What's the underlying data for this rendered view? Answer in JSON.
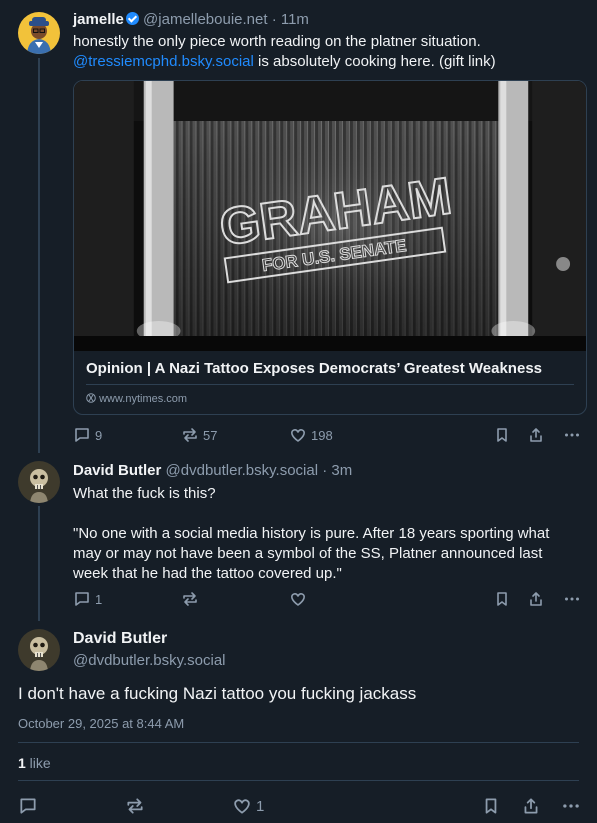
{
  "posts": [
    {
      "author_name": "jamelle",
      "handle": "@jamellebouie.net",
      "time": "· 11m",
      "text_line1": "honestly the only piece worth reading on the platner situation.",
      "mention": "@tressiemcphd.bsky.social",
      "text_line2_rest": " is absolutely cooking here. (gift link)",
      "card": {
        "image_text_main": "GRAHAM",
        "image_text_sub": "FOR U.S. SENATE",
        "title": "Opinion | A Nazi Tattoo Exposes Democrats’ Greatest Weakness",
        "domain": "www.nytimes.com"
      },
      "replies": "9",
      "reposts": "57",
      "likes": "198"
    },
    {
      "author_name": "David Butler",
      "handle": "@dvdbutler.bsky.social",
      "time": "· 3m",
      "text_line1": "What the fuck is this?",
      "quote_line1": "\"No one with a social media history is pure. After 18 years sporting what",
      "quote_line2": "may or may not have been a symbol of the SS, Platner announced last",
      "quote_line3": "week that he had the tattoo covered up.\"",
      "replies": "1",
      "reposts": "",
      "likes": ""
    }
  ],
  "main_post": {
    "author_name": "David Butler",
    "handle": "@dvdbutler.bsky.social",
    "text": "I don't have a fucking Nazi tattoo you fucking jackass",
    "timestamp": "October 29, 2025 at 8:44 AM",
    "like_count": "1",
    "like_label": " like",
    "likes_action_count": "1"
  },
  "colors": {
    "background": "#161e27",
    "accent": "#208bfe",
    "muted": "#8d9cad",
    "border": "#2e4052"
  }
}
